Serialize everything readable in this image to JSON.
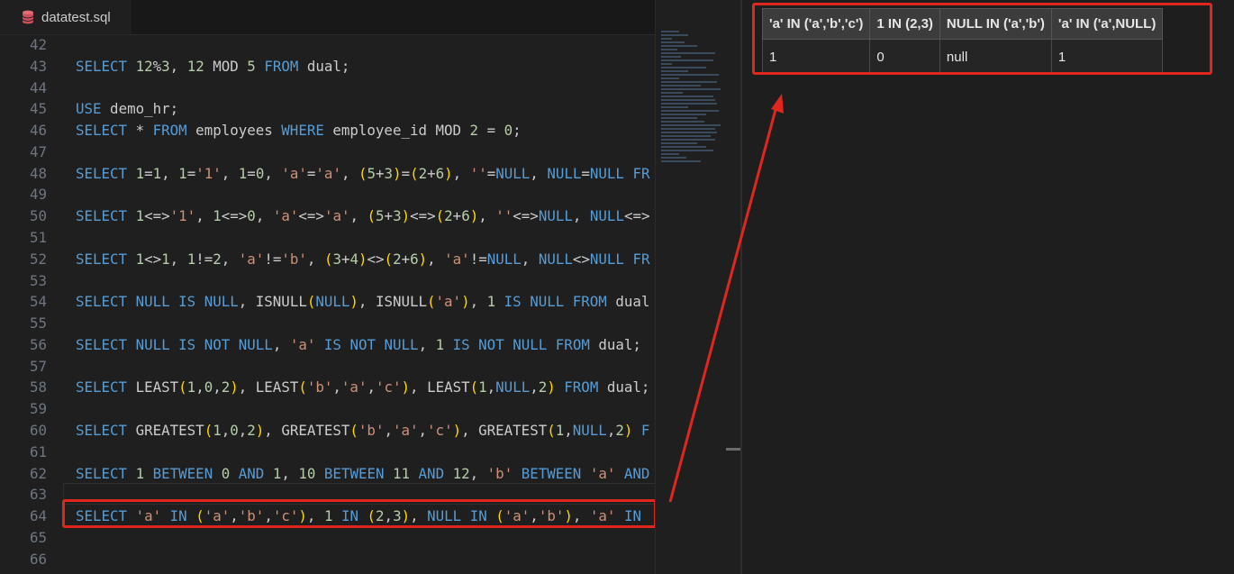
{
  "tab": {
    "filename": "datatest.sql",
    "icon": "database-icon"
  },
  "code_lines": [
    {
      "n": "42",
      "html": ""
    },
    {
      "n": "43",
      "html": "<span class='kw'>SELECT</span> <span class='nm'>12</span>%<span class='nm'>3</span>, <span class='nm'>12</span> MOD <span class='nm'>5</span> <span class='kw'>FROM</span> dual;"
    },
    {
      "n": "44",
      "html": ""
    },
    {
      "n": "45",
      "html": "<span class='kw'>USE</span> demo_hr;"
    },
    {
      "n": "46",
      "html": "<span class='kw'>SELECT</span> * <span class='kw'>FROM</span> employees <span class='kw'>WHERE</span> employee_id MOD <span class='nm'>2</span> = <span class='nm'>0</span>;"
    },
    {
      "n": "47",
      "html": ""
    },
    {
      "n": "48",
      "html": "<span class='kw'>SELECT</span> <span class='nm'>1</span>=<span class='nm'>1</span>, <span class='nm'>1</span>=<span class='st'>'1'</span>, <span class='nm'>1</span>=<span class='nm'>0</span>, <span class='st'>'a'</span>=<span class='st'>'a'</span>, <span class='pr'>(</span><span class='nm'>5</span>+<span class='nm'>3</span><span class='pr'>)</span>=<span class='pr'>(</span><span class='nm'>2</span>+<span class='nm'>6</span><span class='pr'>)</span>, <span class='st'>''</span>=<span class='nl'>NULL</span>, <span class='nl'>NULL</span>=<span class='nl'>NULL</span> <span class='kw'>FR</span>"
    },
    {
      "n": "49",
      "html": ""
    },
    {
      "n": "50",
      "html": "<span class='kw'>SELECT</span> <span class='nm'>1</span>&lt;=&gt;<span class='st'>'1'</span>, <span class='nm'>1</span>&lt;=&gt;<span class='nm'>0</span>, <span class='st'>'a'</span>&lt;=&gt;<span class='st'>'a'</span>, <span class='pr'>(</span><span class='nm'>5</span>+<span class='nm'>3</span><span class='pr'>)</span>&lt;=&gt;<span class='pr'>(</span><span class='nm'>2</span>+<span class='nm'>6</span><span class='pr'>)</span>, <span class='st'>''</span>&lt;=&gt;<span class='nl'>NULL</span>, <span class='nl'>NULL</span>&lt;=&gt;"
    },
    {
      "n": "51",
      "html": ""
    },
    {
      "n": "52",
      "html": "<span class='kw'>SELECT</span> <span class='nm'>1</span>&lt;&gt;<span class='nm'>1</span>, <span class='nm'>1</span>!=<span class='nm'>2</span>, <span class='st'>'a'</span>!=<span class='st'>'b'</span>, <span class='pr'>(</span><span class='nm'>3</span>+<span class='nm'>4</span><span class='pr'>)</span>&lt;&gt;<span class='pr'>(</span><span class='nm'>2</span>+<span class='nm'>6</span><span class='pr'>)</span>, <span class='st'>'a'</span>!=<span class='nl'>NULL</span>, <span class='nl'>NULL</span>&lt;&gt;<span class='nl'>NULL</span> <span class='kw'>FR</span>"
    },
    {
      "n": "53",
      "html": ""
    },
    {
      "n": "54",
      "html": "<span class='kw'>SELECT</span> <span class='nl'>NULL</span> <span class='kw'>IS</span> <span class='nl'>NULL</span>, ISNULL<span class='pr'>(</span><span class='nl'>NULL</span><span class='pr'>)</span>, ISNULL<span class='pr'>(</span><span class='st'>'a'</span><span class='pr'>)</span>, <span class='nm'>1</span> <span class='kw'>IS</span> <span class='nl'>NULL</span> <span class='kw'>FROM</span> dual"
    },
    {
      "n": "55",
      "html": ""
    },
    {
      "n": "56",
      "html": "<span class='kw'>SELECT</span> <span class='nl'>NULL</span> <span class='kw'>IS</span> <span class='kw'>NOT</span> <span class='nl'>NULL</span>, <span class='st'>'a'</span> <span class='kw'>IS</span> <span class='kw'>NOT</span> <span class='nl'>NULL</span>, <span class='nm'>1</span> <span class='kw'>IS</span> <span class='kw'>NOT</span> <span class='nl'>NULL</span> <span class='kw'>FROM</span> dual;"
    },
    {
      "n": "57",
      "html": ""
    },
    {
      "n": "58",
      "html": "<span class='kw'>SELECT</span> LEAST<span class='pr'>(</span><span class='nm'>1</span>,<span class='nm'>0</span>,<span class='nm'>2</span><span class='pr'>)</span>, LEAST<span class='pr'>(</span><span class='st'>'b'</span>,<span class='st'>'a'</span>,<span class='st'>'c'</span><span class='pr'>)</span>, LEAST<span class='pr'>(</span><span class='nm'>1</span>,<span class='nl'>NULL</span>,<span class='nm'>2</span><span class='pr'>)</span> <span class='kw'>FROM</span> dual;"
    },
    {
      "n": "59",
      "html": ""
    },
    {
      "n": "60",
      "html": "<span class='kw'>SELECT</span> GREATEST<span class='pr'>(</span><span class='nm'>1</span>,<span class='nm'>0</span>,<span class='nm'>2</span><span class='pr'>)</span>, GREATEST<span class='pr'>(</span><span class='st'>'b'</span>,<span class='st'>'a'</span>,<span class='st'>'c'</span><span class='pr'>)</span>, GREATEST<span class='pr'>(</span><span class='nm'>1</span>,<span class='nl'>NULL</span>,<span class='nm'>2</span><span class='pr'>)</span> <span class='kw'>F</span>"
    },
    {
      "n": "61",
      "html": ""
    },
    {
      "n": "62",
      "html": "<span class='kw'>SELECT</span> <span class='nm'>1</span> <span class='kw'>BETWEEN</span> <span class='nm'>0</span> <span class='kw'>AND</span> <span class='nm'>1</span>, <span class='nm'>10</span> <span class='kw'>BETWEEN</span> <span class='nm'>11</span> <span class='kw'>AND</span> <span class='nm'>12</span>, <span class='st'>'b'</span> <span class='kw'>BETWEEN</span> <span class='st'>'a'</span> <span class='kw'>AND</span>"
    },
    {
      "n": "63",
      "html": ""
    },
    {
      "n": "64",
      "html": "<span class='kw'>SELECT</span> <span class='st'>'a'</span> <span class='kw'>IN</span> <span class='pr'>(</span><span class='st'>'a'</span>,<span class='st'>'b'</span>,<span class='st'>'c'</span><span class='pr'>)</span>, <span class='nm'>1</span> <span class='kw'>IN</span> <span class='pr'>(</span><span class='nm'>2</span>,<span class='nm'>3</span><span class='pr'>)</span>, <span class='nl'>NULL</span> <span class='kw'>IN</span> <span class='pr'>(</span><span class='st'>'a'</span>,<span class='st'>'b'</span><span class='pr'>)</span>, <span class='st'>'a'</span> <span class='kw'>IN</span>"
    },
    {
      "n": "65",
      "html": ""
    },
    {
      "n": "66",
      "html": ""
    }
  ],
  "result": {
    "headers": [
      "'a' IN ('a','b','c')",
      "1 IN (2,3)",
      "NULL IN ('a','b')",
      "'a' IN ('a',NULL)"
    ],
    "rows": [
      [
        "1",
        "0",
        "null",
        "1"
      ]
    ]
  },
  "colors": {
    "highlight": "#e0261f",
    "keyword": "#569cd6",
    "string": "#ce9178",
    "number": "#b5cea8",
    "bracket": "#ffd700"
  }
}
